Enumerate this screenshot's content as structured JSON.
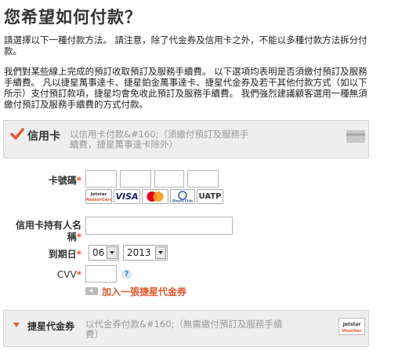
{
  "page": {
    "title": "您希望如何付款？",
    "intro": "請選擇以下一種付款方法。 請注意，除了代金券及信用卡之外，不能以多種付款方法拆分付款。",
    "fee_note": "我們對某些線上完成的預訂收取預訂及服務手續費。 以下選項均表明是否須繳付預訂及服務手續費。 凡以捷星萬事達卡、捷星鉑金萬事達卡、捷星代金券及若干其他付款方式（如以下所示）支付預訂款項，捷星均會免收此預訂及服務手續費。 我們強烈建議顧客選用一種無須繳付預訂及服務手續費的方式付款。"
  },
  "credit_card": {
    "label": "信用卡",
    "description": "以信用卡付款&#160;（須繳付預訂及服務手續費，捷星萬事達卡除外）",
    "card_number_label": "卡號碼",
    "required_mark": "*",
    "card_logos": [
      {
        "name": "jetstar-mastercard",
        "text": "Jetstar MasterCard"
      },
      {
        "name": "visa",
        "text": "VISA"
      },
      {
        "name": "mastercard",
        "text": "MasterCard"
      },
      {
        "name": "diners-club",
        "text": "Diners Club"
      },
      {
        "name": "uatp",
        "text": "UATP"
      }
    ],
    "holder_label": "信用卡持有人名稱",
    "expiry_label": "到期日",
    "expiry_month": "06",
    "expiry_year": "2013",
    "cvv_label": "CVV",
    "help_mark": "?",
    "add_voucher_link": "加入一張捷星代金券"
  },
  "voucher": {
    "label": "捷星代金券",
    "description": "以代金券付款&#160;（無需繳付預訂及服務手續費）",
    "logo_text": "Jetstar Voucher"
  },
  "colors": {
    "accent": "#e8582c",
    "panel_bg": "#eeeeee",
    "muted_text": "#999999"
  }
}
